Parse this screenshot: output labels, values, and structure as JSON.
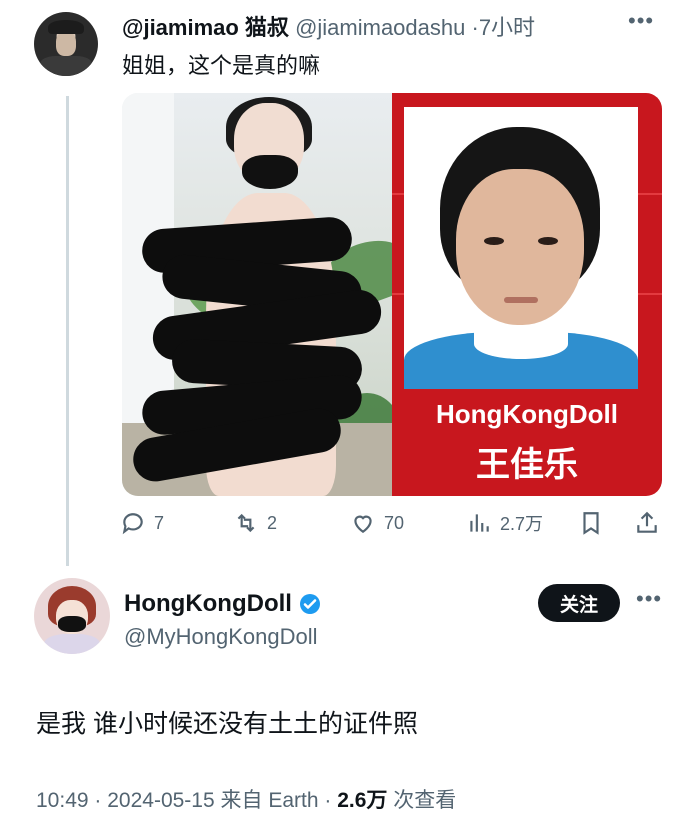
{
  "tweet1": {
    "display_name": "@jiamimao 猫叔",
    "handle": "@jiamimaodashu",
    "separator": "·",
    "time": "7小时",
    "text": "姐姐，这个是真的嘛",
    "image_caption_en": "HongKongDoll",
    "image_caption_cn": "王佳乐",
    "actions": {
      "replies": "7",
      "retweets": "2",
      "likes": "70",
      "views": "2.7万"
    }
  },
  "tweet2": {
    "display_name": "HongKongDoll",
    "handle": "@MyHongKongDoll",
    "follow_label": "关注",
    "text": "是我 谁小时候还没有土土的证件照",
    "time": "10:49",
    "date": "2024-05-15",
    "source_prefix": "来自",
    "source": "Earth",
    "views_count": "2.6万",
    "views_label": "次查看"
  },
  "colors": {
    "text_primary": "#0f1419",
    "text_secondary": "#536471",
    "verified_blue": "#1d9bf0",
    "id_card_red": "#c8171e"
  },
  "icons": [
    "reply-icon",
    "retweet-icon",
    "like-icon",
    "views-icon",
    "bookmark-icon",
    "share-icon",
    "verified-icon",
    "more-icon"
  ]
}
